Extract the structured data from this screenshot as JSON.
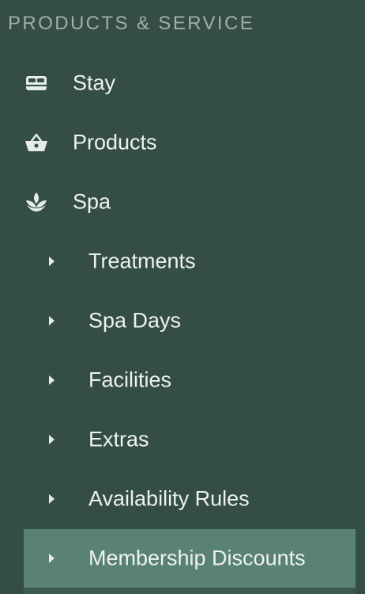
{
  "section": {
    "title": "PRODUCTS & SERVICE"
  },
  "nav": {
    "stay": {
      "label": "Stay",
      "icon": "bed-icon"
    },
    "products": {
      "label": "Products",
      "icon": "basket-icon"
    },
    "spa": {
      "label": "Spa",
      "icon": "lotus-icon"
    }
  },
  "spa_sub": [
    {
      "label": "Treatments",
      "active": false
    },
    {
      "label": "Spa Days",
      "active": false
    },
    {
      "label": "Facilities",
      "active": false
    },
    {
      "label": "Extras",
      "active": false
    },
    {
      "label": "Availability Rules",
      "active": false
    },
    {
      "label": "Membership Discounts",
      "active": true
    }
  ],
  "colors": {
    "background": "#344e45",
    "active_item": "#5a8272",
    "section_title": "#9fb0a6",
    "text": "#eef2ee"
  }
}
